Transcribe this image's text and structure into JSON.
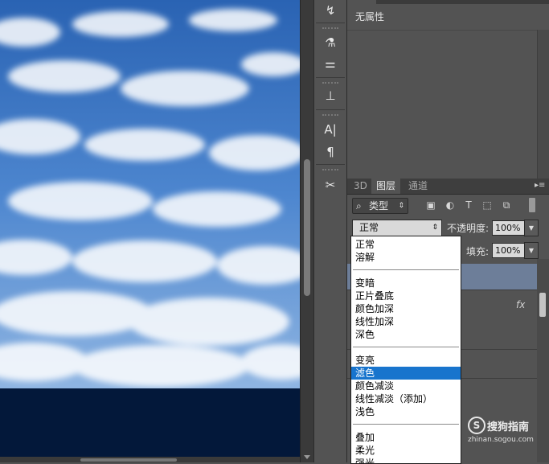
{
  "properties": {
    "title": "无属性"
  },
  "layers_panel": {
    "tabs": [
      {
        "label": "3D",
        "active": false
      },
      {
        "label": "图层",
        "active": true
      },
      {
        "label": "通道",
        "active": false
      }
    ],
    "filter_kind": "类型",
    "blend_mode": "正常",
    "opacity_label": "不透明度:",
    "opacity_value": "100%",
    "fill_label": "填充:",
    "fill_value": "100%",
    "fx_label": "fx"
  },
  "blend_dropdown": {
    "selected": "滤色",
    "groups": [
      [
        "正常",
        "溶解"
      ],
      [
        "变暗",
        "正片叠底",
        "颜色加深",
        "线性加深",
        "深色"
      ],
      [
        "变亮",
        "滤色",
        "颜色减淡",
        "线性减淡（添加）",
        "浅色"
      ],
      [
        "叠加",
        "柔光",
        "强光"
      ]
    ]
  },
  "watermark": {
    "brand": "搜狗指南",
    "url": "zhinan.sogou.com"
  },
  "colors": {
    "panel_bg": "#535353",
    "selection": "#1874cd",
    "sky": "#2f6fc1"
  }
}
